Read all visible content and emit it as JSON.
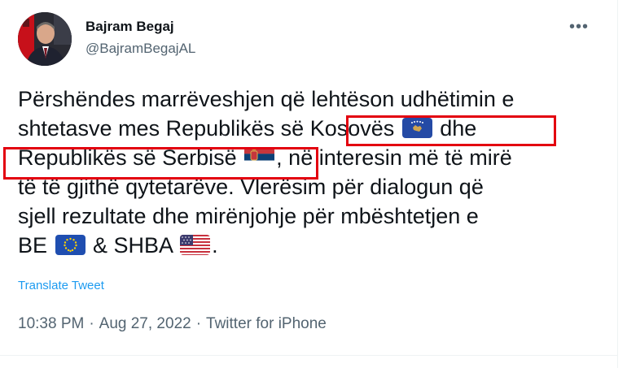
{
  "author": {
    "name": "Bajram Begaj",
    "handle": "@BajramBegajAL"
  },
  "more_label": "•••",
  "tweet": {
    "l1": "Përshëndes marrëveshjen që lehtëson udhëtimin e",
    "l2a": "shtetasve mes Republikës së ",
    "l2b": "Kosovës",
    "l2c": " dhe",
    "l3a": "Republikës së Serbisë",
    "l3b": ", në interesin më të mirë",
    "l4": "të të gjithë qytetarëve. Vlerësim për dialogun që",
    "l5": "sjell rezultate dhe mirënjohje për mbështetjen e",
    "l6a": "BE ",
    "l6b": " & SHBA ",
    "l6c": "."
  },
  "flags": [
    "kosovo-flag-icon",
    "serbia-flag-icon",
    "eu-flag-icon",
    "usa-flag-icon"
  ],
  "translate_label": "Translate Tweet",
  "meta": {
    "time": "10:38 PM",
    "sep": "·",
    "date": "Aug 27, 2022",
    "client": "Twitter for iPhone"
  },
  "colors": {
    "text": "#0f1419",
    "secondary": "#536471",
    "link": "#1d9bf0",
    "highlight": "#e3000f"
  }
}
